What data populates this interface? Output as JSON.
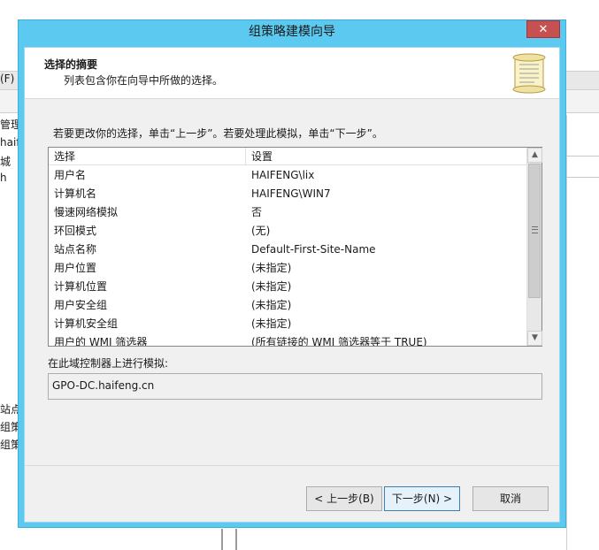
{
  "background_app": {
    "menu_text": "(F)",
    "tree_items": [
      "管理",
      "haife",
      "城",
      "h",
      "",
      "",
      "",
      "",
      "",
      "",
      "",
      "站点",
      "组策",
      "组策"
    ]
  },
  "dialog": {
    "title": "组策略建模向导",
    "close_icon": "✕",
    "header": {
      "title": "选择的摘要",
      "subtitle": "列表包含你在向导中所做的选择。",
      "icon": "scroll-icon"
    },
    "instruction": "若要更改你的选择，单击“上一步”。若要处理此模拟，单击“下一步”。",
    "list": {
      "columns": [
        "选择",
        "设置"
      ],
      "rows": [
        {
          "selection": "用户名",
          "setting": "HAIFENG\\lix"
        },
        {
          "selection": "计算机名",
          "setting": "HAIFENG\\WIN7"
        },
        {
          "selection": "慢速网络模拟",
          "setting": "否"
        },
        {
          "selection": "环回模式",
          "setting": "(无)"
        },
        {
          "selection": "站点名称",
          "setting": "Default-First-Site-Name"
        },
        {
          "selection": "用户位置",
          "setting": "(未指定)"
        },
        {
          "selection": "计算机位置",
          "setting": "(未指定)"
        },
        {
          "selection": "用户安全组",
          "setting": "(未指定)"
        },
        {
          "selection": "计算机安全组",
          "setting": "(未指定)"
        },
        {
          "selection": "用户的 WMI 筛选器",
          "setting": "(所有链接的 WMI 筛选器等于 TRUE)"
        }
      ]
    },
    "dc_label": "在此域控制器上进行模拟:",
    "dc_value": "GPO-DC.haifeng.cn",
    "buttons": {
      "back": "< 上一步(B)",
      "next": "下一步(N) >",
      "cancel": "取消"
    }
  }
}
